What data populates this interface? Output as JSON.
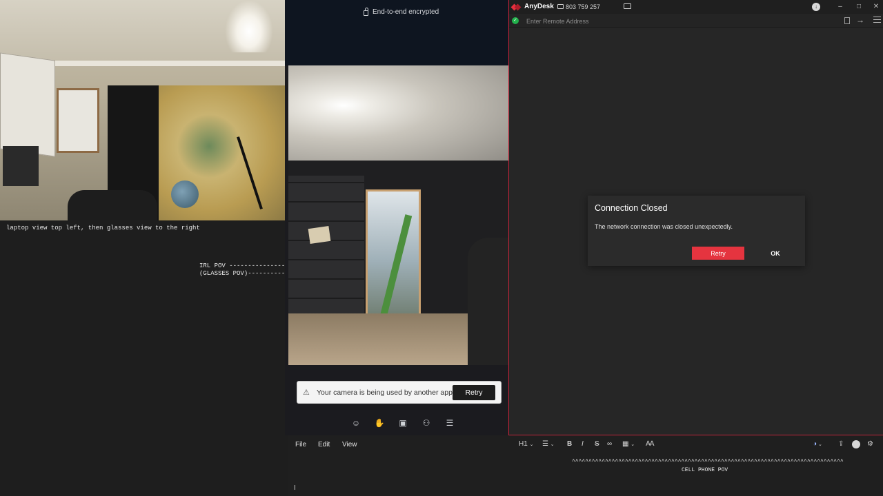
{
  "notes": {
    "top": "laptop view top left, then glasses view to the right",
    "irl_pov": "IRL POV --------------->",
    "glasses_pov": "(GLASSES POV)---------->"
  },
  "call": {
    "encryption": "End-to-end encrypted",
    "camera_warning": "Your camera is being used by another app.",
    "retry_label": "Retry",
    "controls": [
      "emoji-icon",
      "raise-hand-icon",
      "share-screen-icon",
      "add-person-icon",
      "more-options-icon"
    ]
  },
  "anydesk": {
    "title": "AnyDesk",
    "id": "803 759 257",
    "address_placeholder": "Enter Remote Address",
    "dialog": {
      "title": "Connection Closed",
      "message": "The network connection was closed unexpectedly.",
      "retry": "Retry",
      "ok": "OK"
    },
    "accent": "#e5343f"
  },
  "editor": {
    "menu": [
      "File",
      "Edit",
      "View"
    ],
    "heading": "H1",
    "formatting": [
      "B",
      "I",
      "S"
    ],
    "caret_line": "^^^^^^^^^^^^^^^^^^^^^^^^^^^^^^^^^^^^^^^^^^^^^^^^^^^^^^^^^^^^^^^^^^^^^^^^^^^^^^^^^^",
    "label": "CELL PHONE POV"
  }
}
